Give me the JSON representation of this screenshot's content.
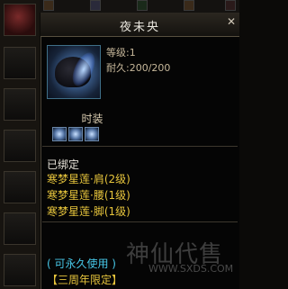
{
  "item": {
    "name": "夜未央",
    "level_line": "等级:1",
    "durability_line": "耐久:200/200"
  },
  "section": {
    "title": "时装"
  },
  "status": {
    "bound": "已绑定"
  },
  "set_items": [
    "寒梦星莲·肩(2级)",
    "寒梦星莲·腰(1级)",
    "寒梦星莲·脚(1级)"
  ],
  "usage": {
    "permanent": "( 可永久使用 )",
    "limited": "【三周年限定】"
  },
  "watermark": {
    "logo_text": "神仙代售",
    "url": "WWW.SXDS.COM"
  }
}
